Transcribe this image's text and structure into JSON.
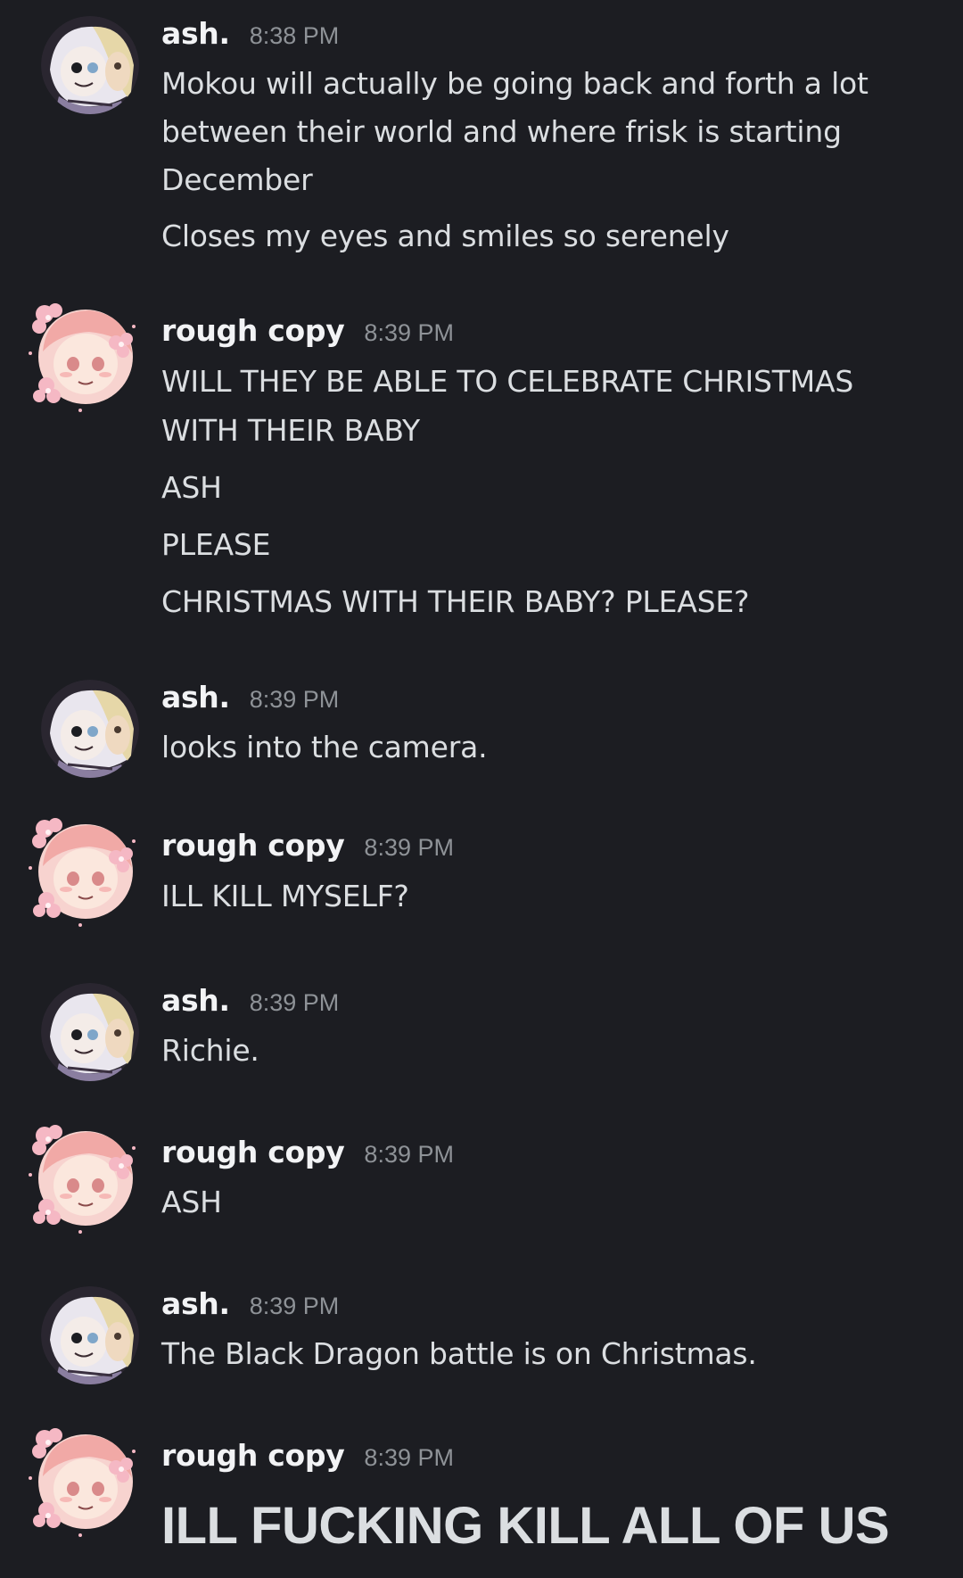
{
  "messages": [
    {
      "author": "ash.",
      "avatar_icon": "user-avatar-ash",
      "time": "8:38 PM",
      "lines": [
        "Mokou will actually be going back and forth a lot",
        "between their world and where frisk is starting",
        "December",
        "Closes my eyes and smiles so serenely"
      ]
    },
    {
      "author": "rough copy",
      "avatar_icon": "user-avatar-rough-copy",
      "time": "8:39 PM",
      "lines": [
        "WILL THEY BE ABLE TO CELEBRATE CHRISTMAS",
        "WITH THEIR BABY",
        "ASH",
        "PLEASE",
        "CHRISTMAS WITH THEIR BABY? PLEASE?"
      ]
    },
    {
      "author": "ash.",
      "avatar_icon": "user-avatar-ash",
      "time": "8:39 PM",
      "lines": [
        "looks into the camera."
      ]
    },
    {
      "author": "rough copy",
      "avatar_icon": "user-avatar-rough-copy",
      "time": "8:39 PM",
      "lines": [
        "ILL KILL MYSELF?"
      ]
    },
    {
      "author": "ash.",
      "avatar_icon": "user-avatar-ash",
      "time": "8:39 PM",
      "lines": [
        "Richie."
      ]
    },
    {
      "author": "rough copy",
      "avatar_icon": "user-avatar-rough-copy",
      "time": "8:39 PM",
      "lines": [
        "ASH"
      ]
    },
    {
      "author": "ash.",
      "avatar_icon": "user-avatar-ash",
      "time": "8:39 PM",
      "lines": [
        "The Black Dragon battle is on Christmas."
      ]
    },
    {
      "author": "rough copy",
      "avatar_icon": "user-avatar-rough-copy",
      "time": "8:39 PM",
      "lines": [
        "ILL FUCKING KILL ALL OF US"
      ]
    }
  ],
  "colors": {
    "background": "#1c1d22",
    "username": "#f2f3f5",
    "text": "#dbdee1",
    "timestamp": "#8e9297"
  }
}
